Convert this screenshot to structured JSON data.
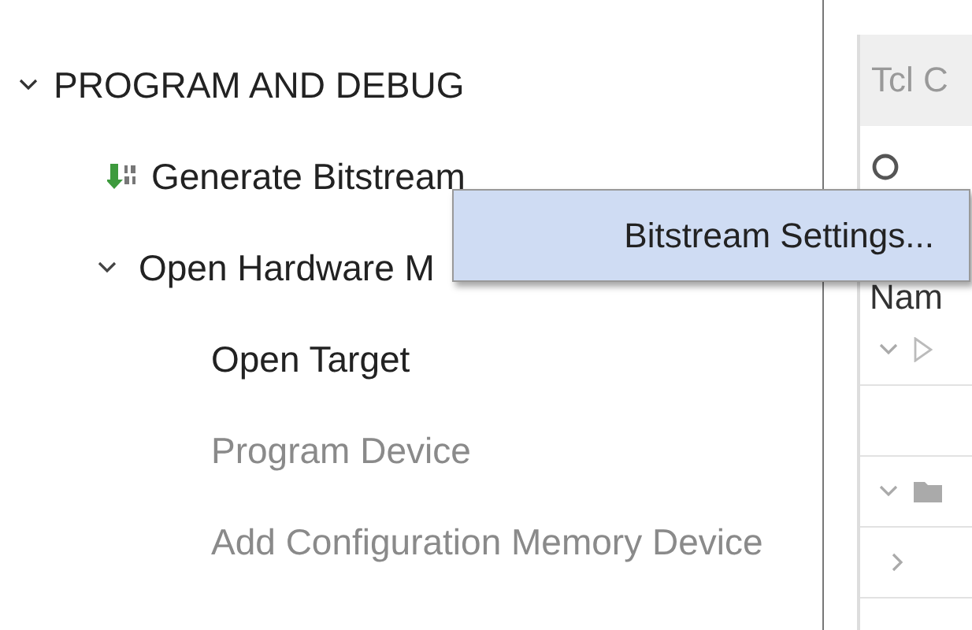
{
  "flow_navigator": {
    "sections": [
      {
        "label": "PROGRAM AND DEBUG",
        "expanded": true,
        "children": [
          {
            "label": "Generate Bitstream",
            "kind": "bitstream",
            "disabled": false
          },
          {
            "label": "Open Hardware M",
            "kind": "group",
            "expanded": true,
            "disabled": false,
            "children": [
              {
                "label": "Open Target",
                "disabled": false
              },
              {
                "label": "Program Device",
                "disabled": true
              },
              {
                "label": "Add Configuration Memory Device",
                "disabled": true
              }
            ]
          }
        ]
      }
    ]
  },
  "context_menu": {
    "items": [
      {
        "label": "Bitstream Settings...",
        "selected": true
      }
    ]
  },
  "tcl_panel": {
    "title": "Tcl C",
    "column_header": "Nam",
    "rows": [
      {
        "kind": "run",
        "expanded": true
      },
      {
        "kind": "blank"
      },
      {
        "kind": "folder",
        "expanded": true
      },
      {
        "kind": "item",
        "expanded": false
      },
      {
        "kind": "blank"
      }
    ]
  }
}
